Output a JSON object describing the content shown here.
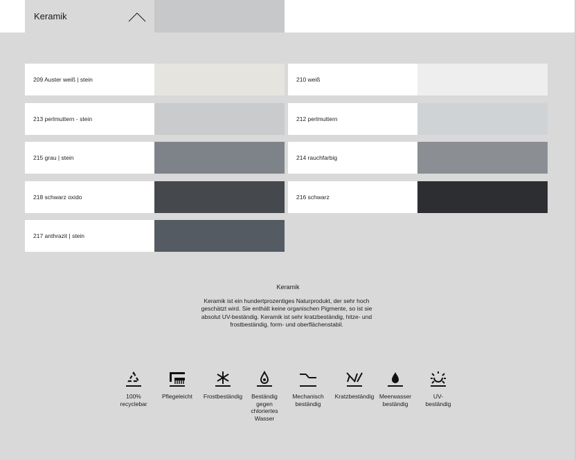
{
  "accordion": {
    "title": "Keramik"
  },
  "tiles": [
    {
      "label": "209 Auster weiß | stein",
      "color": "#e5e4df"
    },
    {
      "label": "210 weiß",
      "color": "#eeeeee"
    },
    {
      "label": "213 perlmuttern - stein",
      "color": "#c9cbcc"
    },
    {
      "label": "212 perlmuttern",
      "color": "#d0d3d6"
    },
    {
      "label": "215 grau | stein",
      "color": "#7d8389"
    },
    {
      "label": "214 rauchfarbig",
      "color": "#8b8f93"
    },
    {
      "label": "218 schwarz oxido",
      "color": "#45484c"
    },
    {
      "label": "216 schwarz",
      "color": "#2d2e31"
    },
    {
      "label": "217 anthrazit | stein",
      "color": "#555b63"
    }
  ],
  "info": {
    "title": "Keramik",
    "text": "Keramik ist ein hundertprozentiges Naturprodukt, der sehr hoch geschätzt wird. Sie enthält keine organischen Pigmente, so ist sie absolut UV-beständig. Keramik ist sehr kratzbeständig, hitze- und frostbeständig, form- und oberflächenstabil."
  },
  "features": [
    {
      "icon": "recycle-icon",
      "label": "100%\nrecyclebar"
    },
    {
      "icon": "easy-care-icon",
      "label": "Pflegeleicht"
    },
    {
      "icon": "frost-icon",
      "label": "Frostbeständig"
    },
    {
      "icon": "chlorine-water-icon",
      "label": "Beständig\ngegen\nchloriertes\nWasser"
    },
    {
      "icon": "mechanical-icon",
      "label": "Mechanisch\nbeständig"
    },
    {
      "icon": "scratch-icon",
      "label": "Kratzbeständig"
    },
    {
      "icon": "seawater-icon",
      "label": "Meerwasser\nbeständig"
    },
    {
      "icon": "uv-icon",
      "label": "UV-\nbeständig"
    }
  ]
}
